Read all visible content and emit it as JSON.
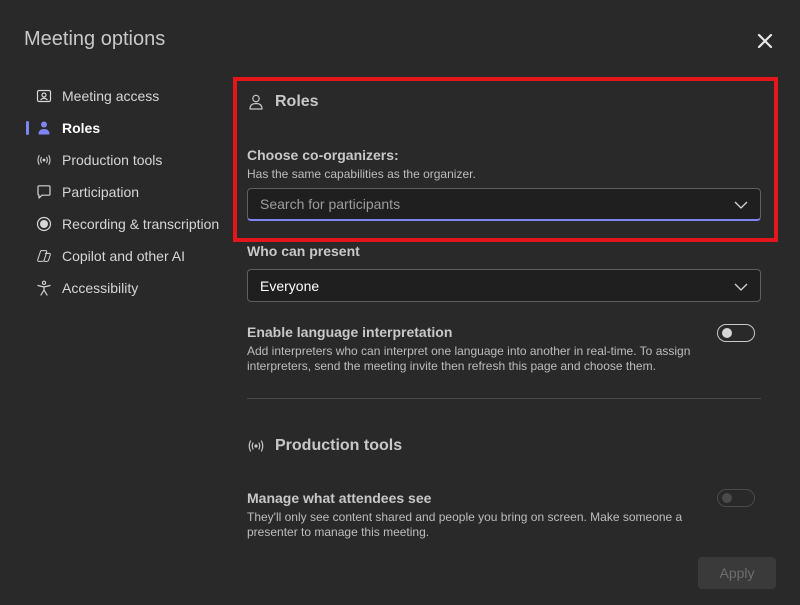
{
  "dialog": {
    "title": "Meeting options",
    "close_icon": "close-icon"
  },
  "sidebar": {
    "items": [
      {
        "label": "Meeting access",
        "icon": "person-card-icon",
        "active": false
      },
      {
        "label": "Roles",
        "icon": "person-icon",
        "active": true
      },
      {
        "label": "Production tools",
        "icon": "broadcast-icon",
        "active": false
      },
      {
        "label": "Participation",
        "icon": "chat-icon",
        "active": false
      },
      {
        "label": "Recording & transcription",
        "icon": "record-icon",
        "active": false
      },
      {
        "label": "Copilot and other AI",
        "icon": "copilot-icon",
        "active": false
      },
      {
        "label": "Accessibility",
        "icon": "accessibility-icon",
        "active": false
      }
    ]
  },
  "roles": {
    "heading": "Roles",
    "co_organizers": {
      "label": "Choose co-organizers:",
      "help": "Has the same capabilities as the organizer.",
      "placeholder": "Search for participants"
    },
    "who_can_present": {
      "label": "Who can present",
      "value": "Everyone"
    },
    "language_interpretation": {
      "label": "Enable language interpretation",
      "help": "Add interpreters who can interpret one language into another in real-time. To assign interpreters, send the meeting invite then refresh this page and choose them.",
      "enabled": false
    }
  },
  "production_tools": {
    "heading": "Production tools",
    "manage_attendees": {
      "label": "Manage what attendees see",
      "help": "They'll only see content shared and people you bring on screen. Make someone a presenter to manage this meeting.",
      "enabled": false,
      "disabled": true
    }
  },
  "footer": {
    "apply_label": "Apply"
  },
  "colors": {
    "accent": "#7f85f5",
    "highlight": "#e3161a",
    "background": "#292929"
  }
}
